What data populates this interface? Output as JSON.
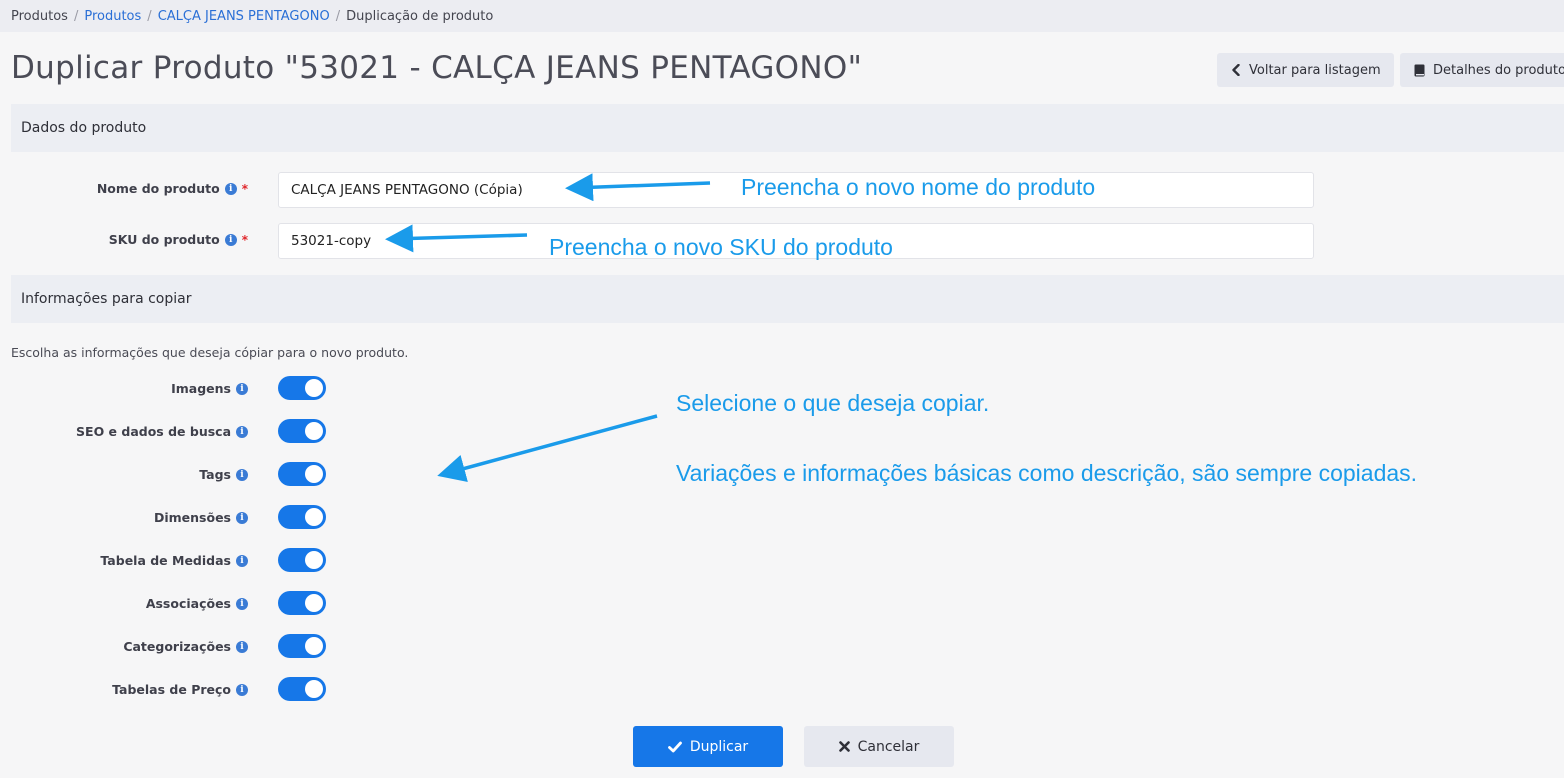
{
  "breadcrumb": {
    "items": [
      "Produtos",
      "Produtos",
      "CALÇA JEANS PENTAGONO",
      "Duplicação de produto"
    ],
    "separator": "/"
  },
  "page_title": "Duplicar Produto \"53021 - CALÇA JEANS PENTAGONO\"",
  "header_buttons": {
    "back_label": "Voltar para listagem",
    "details_label": "Detalhes do produto"
  },
  "sections": {
    "product_data": "Dados do produto",
    "copy_info": "Informações para copiar"
  },
  "fields": {
    "name_label": "Nome do produto",
    "name_value": "CALÇA JEANS PENTAGONO (Cópia)",
    "sku_label": "SKU do produto",
    "sku_value": "53021-copy",
    "required_mark": "*",
    "info_glyph": "i"
  },
  "help_text": "Escolha as informações que deseja cópiar para o novo produto.",
  "toggles": [
    {
      "label": "Imagens",
      "on": true
    },
    {
      "label": "SEO e dados de busca",
      "on": true
    },
    {
      "label": "Tags",
      "on": true
    },
    {
      "label": "Dimensões",
      "on": true
    },
    {
      "label": "Tabela de Medidas",
      "on": true
    },
    {
      "label": "Associações",
      "on": true
    },
    {
      "label": "Categorizações",
      "on": true
    },
    {
      "label": "Tabelas de Preço",
      "on": true
    }
  ],
  "annotations": {
    "name_hint": "Preencha o novo nome do produto",
    "sku_hint": "Preencha o novo SKU do produto",
    "select_hint": "Selecione o que deseja copiar.",
    "variations_hint": "Variações e informações básicas como descrição, são sempre copiadas."
  },
  "footer_buttons": {
    "primary_label": "Duplicar",
    "cancel_label": "Cancelar"
  },
  "colors": {
    "primary": "#1677e8",
    "annotation": "#1a9bea",
    "required": "#e0262b"
  }
}
